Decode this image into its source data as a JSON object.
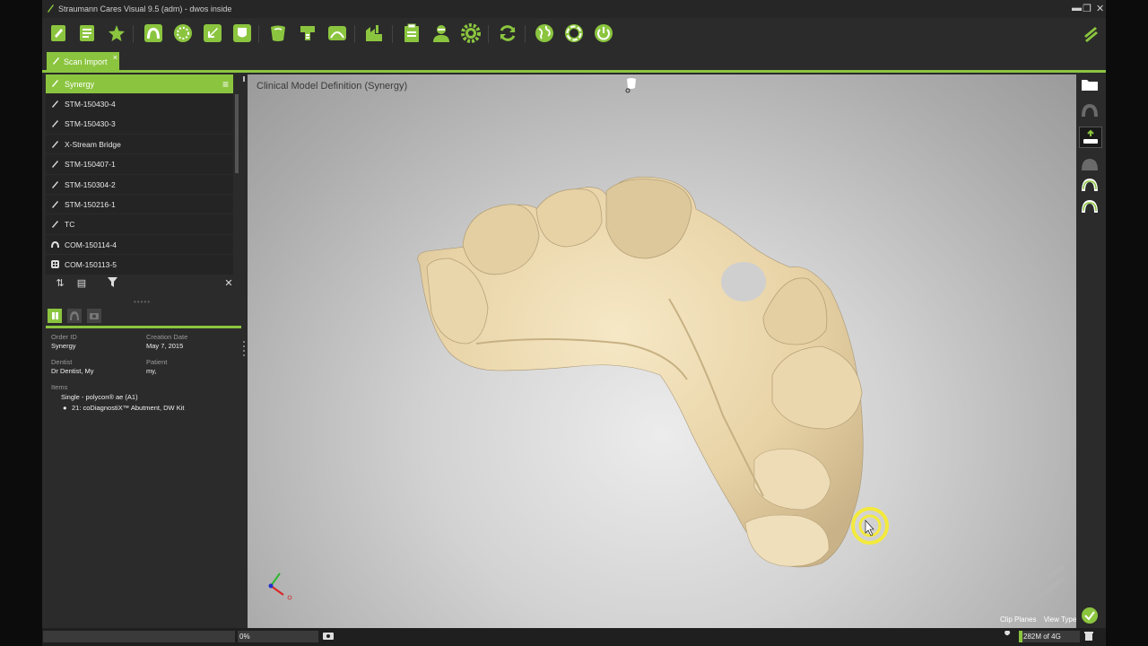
{
  "window": {
    "title": "Straumann Cares Visual 9.5  (adm) - dwos inside",
    "controls": [
      "▬",
      "❐",
      "✕"
    ]
  },
  "toolbar": {
    "buttons": [
      "new-order-icon",
      "order-form-icon",
      "favorites-icon",
      "scan-arch-icon",
      "scan-model-icon",
      "import-icon",
      "export-icon",
      "crown-icon",
      "implant-icon",
      "bridge-icon",
      "lab-icon",
      "documents-icon",
      "dentist-icon",
      "settings-icon",
      "sync-icon",
      "web-icon",
      "support-icon",
      "power-icon"
    ]
  },
  "tab": {
    "label": "Scan Import",
    "close": "×"
  },
  "list": {
    "header": "Synergy",
    "items": [
      {
        "label": "STM-150430-4",
        "icon": "pen-icon"
      },
      {
        "label": "STM-150430-3",
        "icon": "pen-icon"
      },
      {
        "label": "X-Stream Bridge",
        "icon": "pen-icon"
      },
      {
        "label": "STM-150407-1",
        "icon": "pen-icon"
      },
      {
        "label": "STM-150304-2",
        "icon": "pen-icon"
      },
      {
        "label": "STM-150216-1",
        "icon": "pen-icon"
      },
      {
        "label": "TC",
        "icon": "pen-icon"
      },
      {
        "label": "COM-150114-4",
        "icon": "jaw-icon"
      },
      {
        "label": "COM-150113-5",
        "icon": "grid-icon"
      }
    ]
  },
  "details": {
    "order_id_label": "Order ID",
    "order_id": "Synergy",
    "creation_date_label": "Creation Date",
    "creation_date": "May 7, 2015",
    "dentist_label": "Dentist",
    "dentist": "Dr Dentist, My",
    "patient_label": "Patient",
    "patient": "my,",
    "items_label": "Items",
    "item_group": "Single - polycon® ae (A1)",
    "item_line": "21: coDiagnostiX™ Abutment, DW Kit"
  },
  "viewport": {
    "title": "Clinical Model Definition (Synergy)"
  },
  "bottom": {
    "clip_planes": "Clip Planes",
    "view_type": "View Type"
  },
  "status": {
    "progress": "0%",
    "memory": "282M of 4G"
  },
  "colors": {
    "accent": "#8bc53f",
    "model": "#ecd9b0",
    "panel": "#2b2b2b"
  }
}
